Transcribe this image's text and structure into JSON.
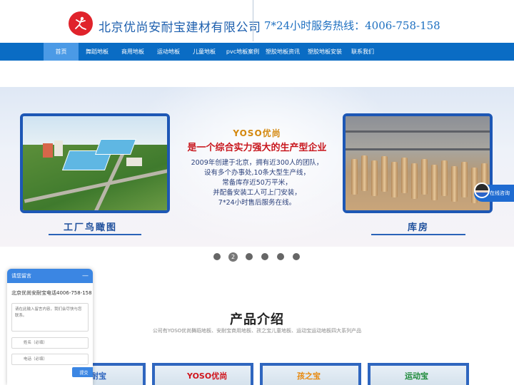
{
  "header": {
    "company_name": "北京优尚安耐宝建材有限公司",
    "hotline": "7*24小时服务热线：4006-758-158",
    "logo_icon": "dancer-logo-icon",
    "brand_color": "#e0232b"
  },
  "nav": {
    "items": [
      {
        "label": "首页",
        "active": true
      },
      {
        "label": "舞蹈地板"
      },
      {
        "label": "商用地板"
      },
      {
        "label": "运动地板"
      },
      {
        "label": "儿童地板"
      },
      {
        "label": "pvc地板案例"
      },
      {
        "label": "塑胶地板资讯"
      },
      {
        "label": "塑胶地板安装"
      },
      {
        "label": "联系我们"
      }
    ],
    "color": "#0a6cc4",
    "active_color": "#4b9ae6"
  },
  "banner": {
    "brand_line": "YOSO优尚",
    "headline": "是一个综合实力强大的生产型企业",
    "description": [
      "2009年创建于北京，拥有近300人的团队，",
      "设有多个办事处,10条大型生产线，",
      "常备库存近50万平米，",
      "并配备安装工人可上门安装，",
      "7*24小时售后服务在线。"
    ],
    "left_caption": "工厂鸟瞰图",
    "right_caption": "库房",
    "chat_label": "在线咨询"
  },
  "carousel": {
    "count": 6,
    "active_index": 1,
    "active_label": "2"
  },
  "products": {
    "title": "产品介绍",
    "subtitle": "公司有YOSO优尚舞蹈地板、安耐宝商用地板、孩之宝儿童地板、运动宝运动地板四大系列产品",
    "cards": [
      {
        "brand": "安耐宝",
        "color": "#2f66bf"
      },
      {
        "brand": "YOSO优尚",
        "color": "#d0141c"
      },
      {
        "brand": "孩之宝",
        "color": "#e88a10"
      },
      {
        "brand": "运动宝",
        "color": "#1d8a3a"
      }
    ]
  },
  "message_widget": {
    "title": "请您留言",
    "minimize": "—",
    "phone_line": "北京优尚安耐宝电话4006-758-158",
    "textarea_placeholder": "请在此输入留言内容，我们会尽快与您联系。",
    "name_placeholder": "姓名（必填）",
    "phone_placeholder": "电话（必填）",
    "submit_label": "提交",
    "name_icon": "user-icon",
    "phone_icon": "phone-icon"
  }
}
